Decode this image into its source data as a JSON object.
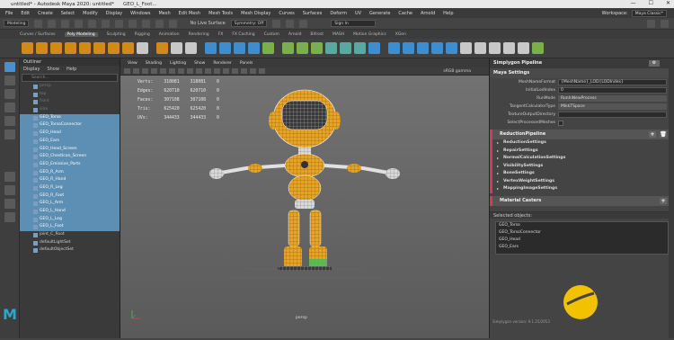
{
  "window": {
    "title": "untitled* - Autodesk Maya 2020: untitled*",
    "tab": "GEO_L_Foot...",
    "controls": [
      "—",
      "☐",
      "✕"
    ]
  },
  "menubar": {
    "items": [
      "File",
      "Edit",
      "Create",
      "Select",
      "Modify",
      "Display",
      "Windows",
      "Mesh",
      "Edit Mesh",
      "Mesh Tools",
      "Mesh Display",
      "Curves",
      "Surfaces",
      "Deform",
      "UV",
      "Generate",
      "Cache",
      "Arnold",
      "Help"
    ],
    "workspace_label": "Workspace:",
    "workspace_value": "Maya Classic*"
  },
  "statusline": {
    "mode": "Modeling",
    "live_surface": "No Live Surface",
    "symmetry": "Symmetry: Off",
    "sign_in": "Sign In"
  },
  "shelf": {
    "tabs": [
      "Curves / Surfaces",
      "Poly Modeling",
      "Sculpting",
      "Rigging",
      "Animation",
      "Rendering",
      "FX",
      "FX Caching",
      "Custom",
      "Arnold",
      "Bifrost",
      "MASH",
      "Motion Graphics",
      "XGen"
    ],
    "active_tab": "Poly Modeling"
  },
  "outliner": {
    "title": "Outliner",
    "menu": [
      "Display",
      "Show",
      "Help"
    ],
    "search_placeholder": "Search...",
    "items": [
      {
        "label": "persp",
        "state": "dim"
      },
      {
        "label": "top",
        "state": "dim"
      },
      {
        "label": "front",
        "state": "dim"
      },
      {
        "label": "side",
        "state": "dim"
      },
      {
        "label": "GEO_Torso",
        "state": "sel"
      },
      {
        "label": "GEO_TorsoConnector",
        "state": "sel"
      },
      {
        "label": "GEO_Head",
        "state": "sel"
      },
      {
        "label": "GEO_Ears",
        "state": "sel"
      },
      {
        "label": "GEO_Head_Screen",
        "state": "sel"
      },
      {
        "label": "GEO_Chestlcon_Screen",
        "state": "sel"
      },
      {
        "label": "GEO_Emissive_Parts",
        "state": "sel"
      },
      {
        "label": "GEO_R_Arm",
        "state": "sel"
      },
      {
        "label": "GEO_R_Hand",
        "state": "sel"
      },
      {
        "label": "GEO_R_Leg",
        "state": "sel"
      },
      {
        "label": "GEO_R_Foot",
        "state": "sel"
      },
      {
        "label": "GEO_L_Arm",
        "state": "sel"
      },
      {
        "label": "GEO_L_Hand",
        "state": "sel"
      },
      {
        "label": "GEO_L_Leg",
        "state": "sel"
      },
      {
        "label": "GEO_L_Foot",
        "state": "sel"
      },
      {
        "label": "joint_C_Root",
        "state": ""
      },
      {
        "label": "defaultLightSet",
        "state": ""
      },
      {
        "label": "defaultObjectSet",
        "state": ""
      }
    ]
  },
  "viewport": {
    "menu": [
      "View",
      "Shading",
      "Lighting",
      "Show",
      "Renderer",
      "Panels"
    ],
    "color_space": "sRGB gamma",
    "camera": "persp",
    "stats": [
      {
        "label": "Verts:",
        "a": "318081",
        "b": "318081",
        "c": "0"
      },
      {
        "label": "Edges:",
        "a": "620710",
        "b": "620710",
        "c": "0"
      },
      {
        "label": "Faces:",
        "a": "307108",
        "b": "307108",
        "c": "0"
      },
      {
        "label": "Tris:",
        "a": "625420",
        "b": "625420",
        "c": "0"
      },
      {
        "label": "UVs:",
        "a": "344433",
        "b": "344433",
        "c": "0"
      }
    ]
  },
  "simplygon": {
    "title": "Simplygon Pipeline",
    "settings_header": "Maya Settings",
    "fields": [
      {
        "label": "MeshNameFormat",
        "value": "{MeshName}_LOD{LODIndex}",
        "kind": "text"
      },
      {
        "label": "InitialLodIndex",
        "value": "0",
        "kind": "text"
      },
      {
        "label": "RunMode",
        "value": "RunInNewProcess",
        "kind": "dd"
      },
      {
        "label": "TangentCalculatorType",
        "value": "MikkTSpace",
        "kind": "dd"
      },
      {
        "label": "TextureOutputDirectory",
        "value": "",
        "kind": "text"
      },
      {
        "label": "SelectProcessedMeshes",
        "value": "",
        "kind": "cb"
      }
    ],
    "reduction_header": "ReductionPipeline",
    "reduction_items": [
      "ReductionSettings",
      "RepairSettings",
      "NormalCalculationSettings",
      "VisibilitySettings",
      "BoneSettings",
      "VertexWeightSettings",
      "MappingImageSettings"
    ],
    "material_header": "Material Casters",
    "selected_header": "Selected objects:",
    "selected_objects": [
      "GEO_Torso",
      "GEO_TorsoConnector",
      "GEO_Head",
      "GEO_Ears"
    ],
    "version": "Simplygon version: 9.1.25/2053"
  },
  "colors": {
    "selection": "#5d8fb4",
    "accent_red": "#d23a5a",
    "simplygon_yellow": "#f2c200",
    "robot_orange": "#e7a321"
  }
}
